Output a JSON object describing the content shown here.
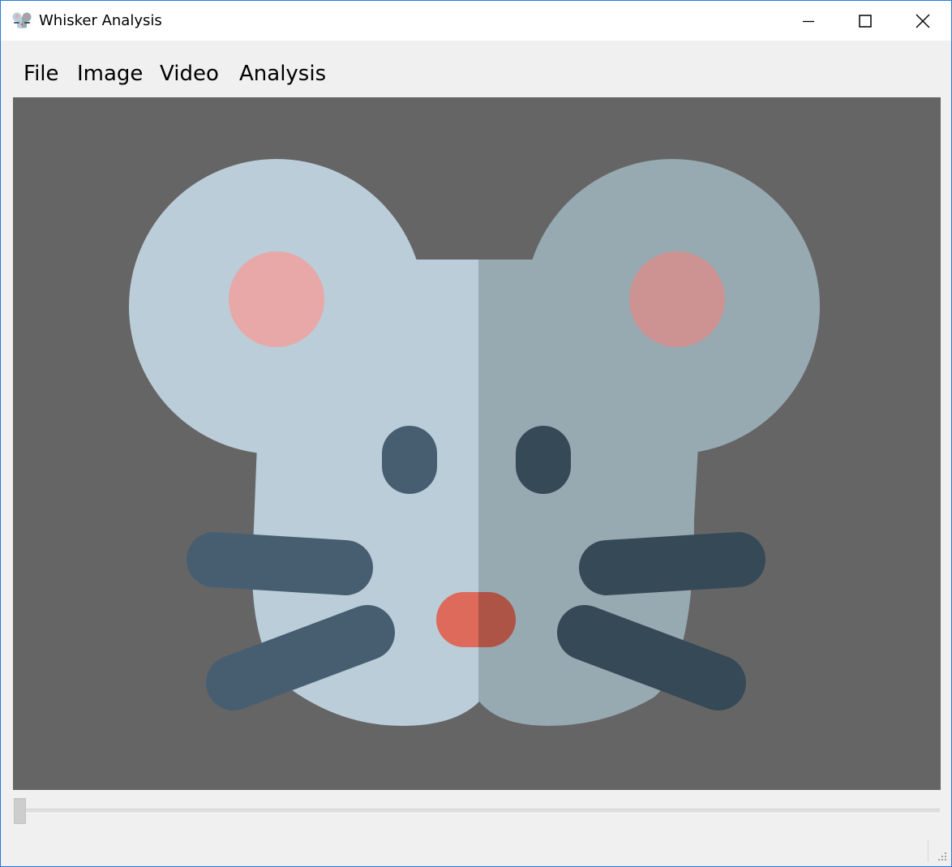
{
  "window": {
    "title": "Whisker Analysis",
    "app_icon": "mouse-icon",
    "controls": {
      "minimize_icon": "minimize-icon",
      "maximize_icon": "maximize-icon",
      "close_icon": "close-icon"
    }
  },
  "menubar": {
    "items": [
      {
        "label": "File"
      },
      {
        "label": "Image"
      },
      {
        "label": "Video"
      },
      {
        "label": "Analysis"
      }
    ]
  },
  "viewer": {
    "image_subject": "mouse-face-illustration",
    "background_color": "#656565"
  },
  "frame_slider": {
    "position": 0
  },
  "colors": {
    "window_border": "#2b79d7",
    "face_light": "#bacdd9",
    "face_dark": "#97a9b1",
    "ear_inner_light": "#e8a8a8",
    "ear_inner_dark": "#cd9393",
    "eye_light": "#475e71",
    "eye_dark": "#364957",
    "nose_light": "#dd6a5b",
    "nose_dark": "#ae5447"
  }
}
